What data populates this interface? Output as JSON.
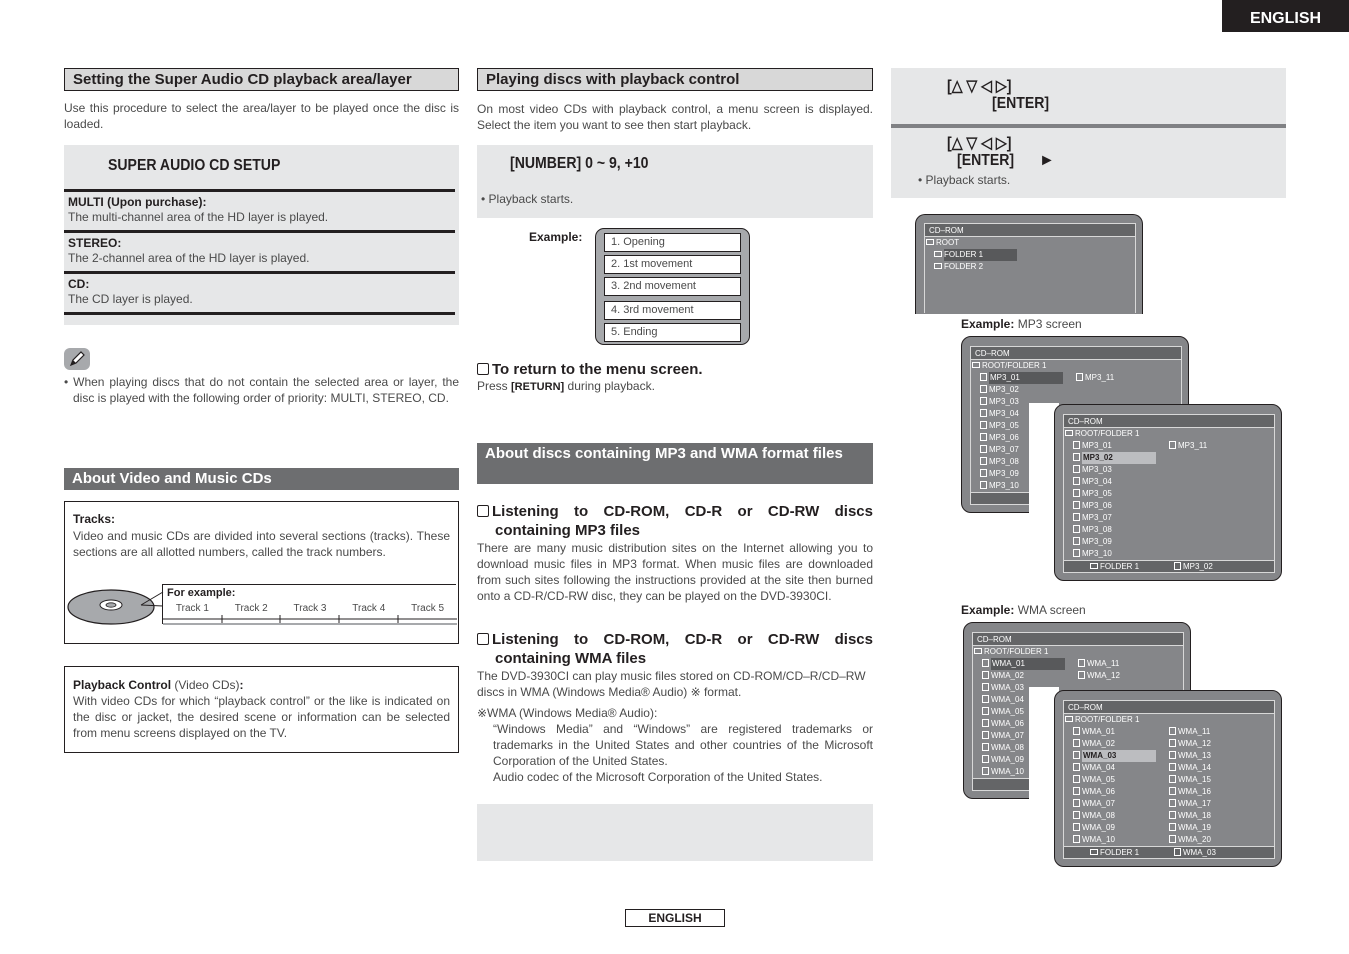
{
  "language_tab": "ENGLISH",
  "footer_language": "ENGLISH",
  "left": {
    "sacd_heading": "Setting the Super Audio CD playback area/layer",
    "sacd_intro": "Use this procedure to select the area/layer to be played once the disc is loaded.",
    "setup_title": "SUPER AUDIO CD SETUP",
    "options": [
      {
        "label": "MULTI (Upon purchase):",
        "desc": "The multi-channel area of the HD layer is played."
      },
      {
        "label": "STEREO:",
        "desc": "The 2-channel area of the HD layer is played."
      },
      {
        "label": "CD:",
        "desc": "The CD layer is played."
      }
    ],
    "note_icon": "pencil-icon",
    "note_text": "When playing discs that do not contain the selected area or layer, the disc is played with the following order of priority: MULTI, STEREO, CD.",
    "video_music_heading": "About Video and Music CDs",
    "tracks_label": "Tracks:",
    "tracks_text": "Video and music CDs are divided into several sections (tracks). These sections are all allotted numbers, called the track numbers.",
    "example_label": "For example:",
    "tracks": [
      "Track 1",
      "Track 2",
      "Track 3",
      "Track 4",
      "Track 5"
    ],
    "pbc_label": "Playback Control",
    "pbc_sub": "(Video CDs)",
    "pbc_colon": ":",
    "pbc_text": "With video CDs for which “playback control” or the like is indicated on the disc or jacket, the desired scene or information can be selected from menu screens displayed on the TV."
  },
  "middle": {
    "pbc_heading": "Playing discs with playback control",
    "pbc_intro": "On most video CDs with playback control, a menu screen is displayed. Select the item you want to see then start playback.",
    "number_key": "[NUMBER]  0 ~ 9, +10",
    "playback_starts": "• Playback starts.",
    "example_label": "Example:",
    "menu_items": [
      "1. Opening",
      "2. 1st movement",
      "3. 2nd movement",
      "4. 3rd movement",
      "5. Ending"
    ],
    "return_heading": "To return to the menu screen.",
    "return_press": "Press ",
    "return_key": "[RETURN]",
    "return_rest": " during playback.",
    "mp3wma_heading": "About discs containing MP3 and WMA format files",
    "mp3_heading": "Listening to CD-ROM, CD-R or CD-RW discs containing MP3 files",
    "mp3_text": "There are many music distribution sites on the Internet allowing you to download music files in MP3 format. When music files are downloaded from such sites following the instructions provided at the site then burned onto a CD-R/CD-RW disc, they can be played on the DVD-3930CI.",
    "wma_heading": "Listening to CD-ROM, CD-R or CD-RW discs containing WMA files",
    "wma_text": "The DVD-3930CI can play music files stored on CD-ROM/CD–R/CD–RW discs in WMA (Windows Media® Audio) ※ format.",
    "wma_note_title": "※WMA (Windows Media® Audio):",
    "wma_note_1": "“Windows Media” and “Windows” are registered trademarks or trademarks in the United States and other countries of the Microsoft Corporation of the United States.",
    "wma_note_2": "Audio codec of the Microsoft Corporation of the United States."
  },
  "right": {
    "step1_arrows": "[△ ▽ ◁ ▷]",
    "step1_enter": "[ENTER]",
    "step2_arrows": "[△ ▽ ◁ ▷]",
    "step2_enter": "[ENTER]",
    "step2_play": "►",
    "playback_starts": "• Playback starts.",
    "folder_screen": {
      "title": "CD–ROM",
      "root": "ROOT",
      "folders": [
        "FOLDER 1",
        "FOLDER 2"
      ],
      "selected": "FOLDER 1"
    },
    "mp3_caption_bold": "Example:",
    "mp3_caption": " MP3 screen",
    "mp3_screen": {
      "title": "CD–ROM",
      "path": "ROOT/FOLDER 1",
      "col1": [
        "MP3_01",
        "MP3_02",
        "MP3_03",
        "MP3_04",
        "MP3_05",
        "MP3_06",
        "MP3_07",
        "MP3_08",
        "MP3_09",
        "MP3_10"
      ],
      "col2": [
        "MP3_11"
      ],
      "back_selected": "MP3_01",
      "front_selected": "MP3_02",
      "footer_folder": "FOLDER 1",
      "footer_file": "MP3_02"
    },
    "wma_caption_bold": "Example:",
    "wma_caption": " WMA screen",
    "wma_screen": {
      "title": "CD–ROM",
      "path": "ROOT/FOLDER 1",
      "col1": [
        "WMA_01",
        "WMA_02",
        "WMA_03",
        "WMA_04",
        "WMA_05",
        "WMA_06",
        "WMA_07",
        "WMA_08",
        "WMA_09",
        "WMA_10"
      ],
      "col2": [
        "WMA_11",
        "WMA_12",
        "WMA_13",
        "WMA_14",
        "WMA_15",
        "WMA_16",
        "WMA_17",
        "WMA_18",
        "WMA_19",
        "WMA_20"
      ],
      "back_selected": "WMA_01",
      "front_selected": "WMA_03",
      "footer_folder": "FOLDER 1",
      "footer_file": "WMA_03"
    }
  }
}
